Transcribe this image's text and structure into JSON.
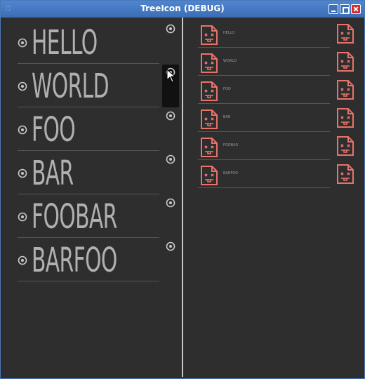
{
  "window": {
    "title": "TreeIcon (DEBUG)"
  },
  "left_list": {
    "items": [
      {
        "label": "HELLO"
      },
      {
        "label": "WORLD"
      },
      {
        "label": "FOO"
      },
      {
        "label": "BAR"
      },
      {
        "label": "FOOBAR"
      },
      {
        "label": "BARFOO"
      }
    ],
    "row_icon": "eye-icon"
  },
  "right_list": {
    "items": [
      {
        "label": "HELLO"
      },
      {
        "label": "WORLD"
      },
      {
        "label": "FOO"
      },
      {
        "label": "BAR"
      },
      {
        "label": "FOOBAR"
      },
      {
        "label": "BARFOO"
      }
    ],
    "row_icon": "broken-file-icon"
  },
  "colors": {
    "titlebar": "#3a6db5",
    "background": "#2e2e2e",
    "text": "#b0b0b0",
    "icon_accent": "#e8736a",
    "separator": "#555555"
  }
}
